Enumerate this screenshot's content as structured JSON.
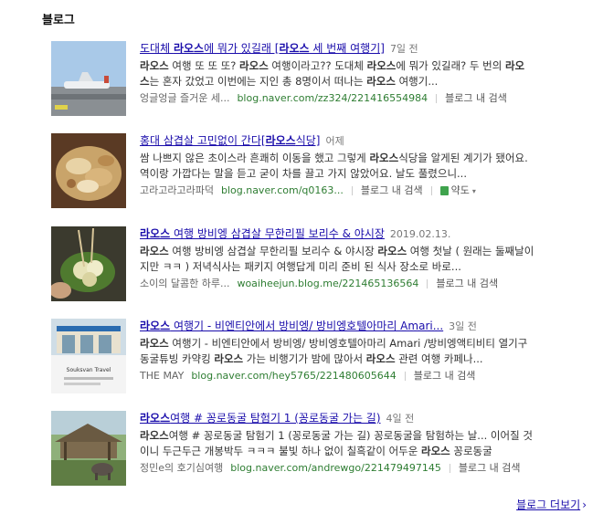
{
  "section": {
    "title": "블로그"
  },
  "results": [
    {
      "title_pre": "도대체 ",
      "title_bold1": "라오스",
      "title_mid": "에 뭐가 있길래 [",
      "title_bold2": "라오스",
      "title_post": " 세 번째 여행기]",
      "date": "7일 전",
      "line1": [
        {
          "t": "라오스",
          "b": true
        },
        {
          "t": " 여행 또 또 또? ",
          "b": false
        },
        {
          "t": "라오스",
          "b": true
        },
        {
          "t": " 여행이라고?? 도대체 ",
          "b": false
        },
        {
          "t": "라오스",
          "b": true
        },
        {
          "t": "에 뭐가 있길래? 두 번의 ",
          "b": false
        },
        {
          "t": "라오",
          "b": true
        }
      ],
      "line2": [
        {
          "t": "스",
          "b": true
        },
        {
          "t": "는 혼자 갔었고 이번에는 지인 총 8명이서 떠나는 ",
          "b": false
        },
        {
          "t": "라오스",
          "b": true
        },
        {
          "t": " 여행기...",
          "b": false
        }
      ],
      "author": "엉글엉글 즐거운 세...",
      "url": "blog.naver.com/zz324/221416554984",
      "search_in": "블로그 내 검색"
    },
    {
      "title_pre": "홍대 삼겹살 고민없이 간다[",
      "title_bold1": "라오스",
      "title_mid": "식당]",
      "title_bold2": "",
      "title_post": "",
      "date": "어제",
      "line1": [
        {
          "t": "쌈 나쁘지 않은 초이스라 흔쾌히 이동을 했고 그렇게 ",
          "b": false
        },
        {
          "t": "라오스",
          "b": true
        },
        {
          "t": "식당을 알게된 계기가 됐어요.",
          "b": false
        }
      ],
      "line2": [
        {
          "t": "역이랑 가깝다는 말을 듣고 굳이 차를 끌고 가지 않았어요. 날도 풀렸으니...",
          "b": false
        }
      ],
      "author": "고라고라고라파덕",
      "url": "blog.naver.com/q0163...",
      "search_in": "블로그 내 검색",
      "map_label": "약도"
    },
    {
      "title_pre": "",
      "title_bold1": "라오스",
      "title_mid": " 여행 방비엥 삼겹살 무한리필 보리수 & 야시장",
      "title_bold2": "",
      "title_post": "",
      "date": "2019.02.13.",
      "line1": [
        {
          "t": "라오스",
          "b": true
        },
        {
          "t": " 여행 방비엥 삼겹살 무한리필 보리수 & 야시장 ",
          "b": false
        },
        {
          "t": "라오스",
          "b": true
        },
        {
          "t": " 여행 첫날 ( 원래는 둘째날이",
          "b": false
        }
      ],
      "line2": [
        {
          "t": "지만 ㅋㅋ ) 저녁식사는 패키지 여행답게 미리 준비 된 식사 장소로 바로...",
          "b": false
        }
      ],
      "author": "소이의 달콤한 하루...",
      "url": "woaiheejun.blog.me/221465136564",
      "search_in": "블로그 내 검색"
    },
    {
      "title_pre": "",
      "title_bold1": "라오스",
      "title_mid": " 여행기 - 비엔티안에서 방비엥/ 방비엥호텔아마리 Amari...",
      "title_bold2": "",
      "title_post": "",
      "date": "3일 전",
      "line1": [
        {
          "t": "라오스",
          "b": true
        },
        {
          "t": " 여행기 - 비엔티안에서 방비엥/ 방비엥호텔아마리 Amari /방비엥액티비티 열기구",
          "b": false
        }
      ],
      "line2": [
        {
          "t": "동굴튜빙 카약킹 ",
          "b": false
        },
        {
          "t": "라오스",
          "b": true
        },
        {
          "t": " 가는 비행기가 밤에 많아서 ",
          "b": false
        },
        {
          "t": "라오스",
          "b": true
        },
        {
          "t": " 관련 여행 카페나...",
          "b": false
        }
      ],
      "author": "THE MAY",
      "url": "blog.naver.com/hey5765/221480605644",
      "search_in": "블로그 내 검색",
      "thumb_text": "Souksvan Travel"
    },
    {
      "title_pre": "",
      "title_bold1": "라오스",
      "title_mid": "여행 # 꽁로동굴 탐험기 1 (꽁로동굴 가는 길)",
      "title_bold2": "",
      "title_post": "",
      "date": "4일 전",
      "line1": [
        {
          "t": "라오스",
          "b": true
        },
        {
          "t": "여행 # 꽁로동굴 탐험기 1 (꽁로동굴 가는 길) 꽁로동굴을 탐험하는 날... 이어질 것",
          "b": false
        }
      ],
      "line2": [
        {
          "t": "이니 두근두근 개봉박두 ㅋㅋㅋ 불빛 하나 없이 칠흑같이 어두운 ",
          "b": false
        },
        {
          "t": "라오스",
          "b": true
        },
        {
          "t": " 꽁로동굴",
          "b": false
        }
      ],
      "author": "정민e의 호기심여행",
      "url": "blog.naver.com/andrewgo/221479497145",
      "search_in": "블로그 내 검색"
    }
  ],
  "more": {
    "label": "블로그 더보기",
    "chevron": "›"
  },
  "icons": {
    "map": "map-pin-icon",
    "caret": "caret-down-icon",
    "chevron": "chevron-right-icon"
  },
  "colors": {
    "link": "#1a0dab",
    "url": "#2e7d32",
    "meta": "#777777"
  }
}
